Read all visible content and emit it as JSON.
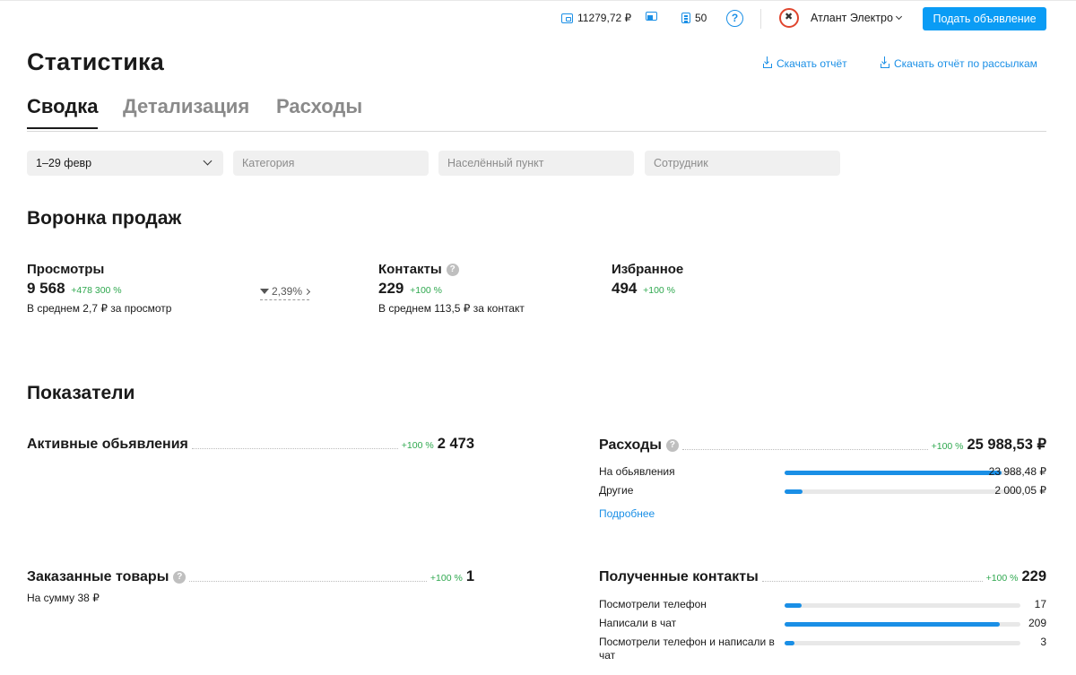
{
  "topbar": {
    "balance": "11279,72 ₽",
    "doc_count": "50",
    "help": "?",
    "account": "Атлант Электро",
    "post_button": "Подать объявление"
  },
  "header": {
    "title": "Статистика",
    "download_report": "Скачать отчёт",
    "download_mailing_report": "Скачать отчёт по рассылкам"
  },
  "tabs": [
    "Сводка",
    "Детализация",
    "Расходы"
  ],
  "filters": {
    "period": "1–29 февр",
    "category_placeholder": "Категория",
    "city_placeholder": "Населённый пункт",
    "employee_placeholder": "Сотрудник"
  },
  "funnel": {
    "title": "Воронка продаж",
    "views": {
      "label": "Просмотры",
      "value": "9 568",
      "delta": "+478 300 %",
      "note": "В среднем 2,7 ₽ за просмотр"
    },
    "conversion": "2,39%",
    "contacts": {
      "label": "Контакты",
      "value": "229",
      "delta": "+100 %",
      "note": "В среднем 113,5 ₽ за контакт"
    },
    "favorites": {
      "label": "Избранное",
      "value": "494",
      "delta": "+100 %"
    }
  },
  "indicators": {
    "title": "Показатели",
    "active_ads": {
      "label": "Активные обьявления",
      "delta": "+100 %",
      "value": "2 473"
    },
    "expenses": {
      "label": "Расходы",
      "delta": "+100 %",
      "value": "25 988,53 ₽",
      "rows": [
        {
          "label": "На обьявления",
          "value": "23 988,48 ₽",
          "share": 0.92
        },
        {
          "label": "Другие",
          "value": "2 000,05 ₽",
          "share": 0.077
        }
      ],
      "more_link": "Подробнее"
    },
    "ordered": {
      "label": "Заказанные товары",
      "delta": "+100 %",
      "value": "1",
      "note": "На сумму 38 ₽"
    },
    "contacts_received": {
      "label": "Полученные контакты",
      "delta": "+100 %",
      "value": "229",
      "rows": [
        {
          "label": "Посмотрели телефон",
          "value": "17",
          "share": 0.074
        },
        {
          "label": "Написали в чат",
          "value": "209",
          "share": 0.913
        },
        {
          "label": "Посмотрели телефон и написали в чат",
          "value": "3",
          "share": 0.013
        }
      ]
    }
  },
  "colors": {
    "accent": "#1a8fe6",
    "button": "#0a9cf5",
    "positive": "#2fa84f"
  }
}
